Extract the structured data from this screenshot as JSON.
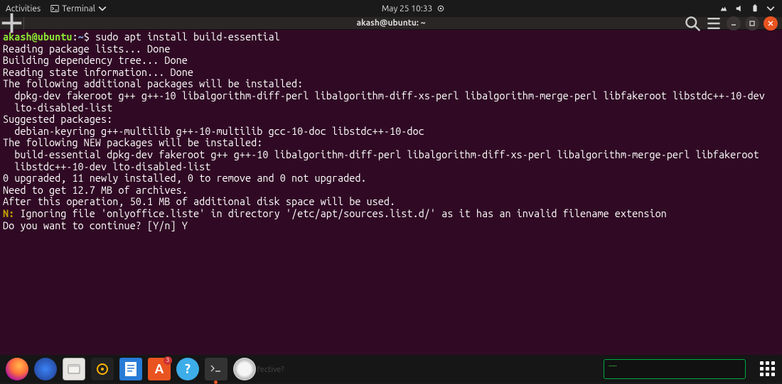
{
  "topbar": {
    "activities": "Activities",
    "app_indicator": "Terminal",
    "clock": "May 25  10:33"
  },
  "window": {
    "title": "akash@ubuntu: ~",
    "prompt_user": "akash@ubuntu",
    "prompt_path": "~",
    "prompt_symbol": "$",
    "command": "sudo apt install build-essential",
    "lines": [
      "Reading package lists... Done",
      "Building dependency tree... Done",
      "Reading state information... Done",
      "The following additional packages will be installed:",
      "  dpkg-dev fakeroot g++ g++-10 libalgorithm-diff-perl libalgorithm-diff-xs-perl libalgorithm-merge-perl libfakeroot libstdc++-10-dev",
      "  lto-disabled-list",
      "Suggested packages:",
      "  debian-keyring g++-multilib g++-10-multilib gcc-10-doc libstdc++-10-doc",
      "The following NEW packages will be installed:",
      "  build-essential dpkg-dev fakeroot g++ g++-10 libalgorithm-diff-perl libalgorithm-diff-xs-perl libalgorithm-merge-perl libfakeroot",
      "  libstdc++-10-dev lto-disabled-list",
      "0 upgraded, 11 newly installed, 0 to remove and 0 not upgraded.",
      "Need to get 12.7 MB of archives.",
      "After this operation, 50.1 MB of additional disk space will be used."
    ],
    "notice_prefix": "N:",
    "notice_text": " Ignoring file 'onlyoffice.liste' in directory '/etc/apt/sources.list.d/' as it has an invalid filename extension",
    "confirm": "Do you want to continue? [Y/n] Y"
  },
  "dock": {
    "faded": "ake   m        fective?"
  }
}
